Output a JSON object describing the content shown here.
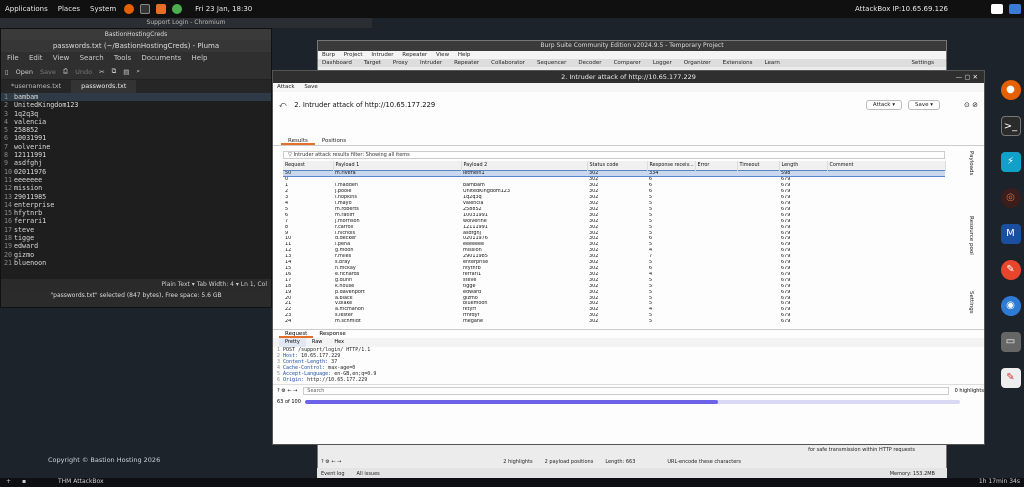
{
  "topbar": {
    "menus": [
      "Applications",
      "Places",
      "System"
    ],
    "clock": "Fri 23 Jan, 18:30",
    "attackbox": "AttackBox IP:10.65.69.126"
  },
  "chromium": {
    "title": "Support Login - Chromium",
    "copyright": "Copyright © Bastion Hosting 2026"
  },
  "pluma": {
    "tab_title": "BastionHostingCreds",
    "title": "passwords.txt (~/BastionHostingCreds) - Pluma",
    "menu": [
      "File",
      "Edit",
      "View",
      "Search",
      "Tools",
      "Documents",
      "Help"
    ],
    "toolbar": [
      "Open",
      "Save",
      "Undo"
    ],
    "tabs": [
      "*usernames.txt",
      "passwords.txt"
    ],
    "lines": [
      {
        "n": "1",
        "t": "bambam"
      },
      {
        "n": "2",
        "t": "UnitedKingdom123"
      },
      {
        "n": "3",
        "t": "1q2q3q"
      },
      {
        "n": "4",
        "t": "valencia"
      },
      {
        "n": "5",
        "t": "258852"
      },
      {
        "n": "6",
        "t": "10031991"
      },
      {
        "n": "7",
        "t": "wolverine"
      },
      {
        "n": "8",
        "t": "12111991"
      },
      {
        "n": "9",
        "t": "asdfghj"
      },
      {
        "n": "10",
        "t": "02011976"
      },
      {
        "n": "11",
        "t": "eeeeeee"
      },
      {
        "n": "12",
        "t": "mission"
      },
      {
        "n": "13",
        "t": "29011985"
      },
      {
        "n": "14",
        "t": "enterprise"
      },
      {
        "n": "15",
        "t": "hfytnrb"
      },
      {
        "n": "16",
        "t": "ferrari1"
      },
      {
        "n": "17",
        "t": "steve"
      },
      {
        "n": "18",
        "t": "tigge"
      },
      {
        "n": "19",
        "t": "edward"
      },
      {
        "n": "20",
        "t": "gizmo"
      },
      {
        "n": "21",
        "t": "bluenoon"
      }
    ],
    "status": "Plain Text ▾   Tab Width: 4 ▾   Ln 1, Col",
    "selection_info": "\"passwords.txt\" selected (847 bytes), Free space: 5.6 GB"
  },
  "burp": {
    "title": "Burp Suite Community Edition v2024.9.5 - Temporary Project",
    "menu": [
      "Burp",
      "Project",
      "Intruder",
      "Repeater",
      "View",
      "Help"
    ],
    "tabs": [
      "Dashboard",
      "Target",
      "Proxy",
      "Intruder",
      "Repeater",
      "Collaborator",
      "Sequencer",
      "Decoder",
      "Comparer",
      "Logger",
      "Organizer",
      "Extensions",
      "Learn"
    ],
    "settings": "Settings",
    "footer_highlights": "2 highlights",
    "footer_positions": "2 payload positions",
    "footer_length": "Length: 663",
    "event_log": "Event log",
    "all_issues": "All issues",
    "memory": "Memory: 153.2MB",
    "urlencode": "URL-encode these characters",
    "safe": "for safe transmission within HTTP requests"
  },
  "intruder": {
    "title": "2. Intruder attack of http://10.65.177.229",
    "menu": [
      "Attack",
      "Save"
    ],
    "heading": "2. Intruder attack of http://10.65.177.229",
    "attack_btn": "Attack ▾",
    "save_btn": "Save ▾",
    "subtabs": [
      "Results",
      "Positions"
    ],
    "filter": "Intruder attack results filter: Showing all items",
    "columns": [
      "Request",
      "Payload 1",
      "Payload 2",
      "Status code",
      "Response receiv...",
      "Error",
      "Timeout",
      "Length",
      "Comment"
    ],
    "rows": [
      [
        "50",
        "m.rivera",
        "letmein1",
        "302",
        "334",
        "",
        "",
        "598",
        ""
      ],
      [
        "0",
        "",
        "",
        "302",
        "6",
        "",
        "",
        "679",
        ""
      ],
      [
        "1",
        "l.madden",
        "bambam",
        "302",
        "6",
        "",
        "",
        "679",
        ""
      ],
      [
        "2",
        "j.poole",
        "UnitedKingdom123",
        "302",
        "6",
        "",
        "",
        "679",
        ""
      ],
      [
        "3",
        "l.hopkins",
        "1q2q3q",
        "302",
        "5",
        "",
        "",
        "679",
        ""
      ],
      [
        "4",
        "l.mayo",
        "valencia",
        "302",
        "5",
        "",
        "",
        "679",
        ""
      ],
      [
        "5",
        "m.roberts",
        "258852",
        "302",
        "5",
        "",
        "",
        "679",
        ""
      ],
      [
        "6",
        "m.ratliff",
        "10031991",
        "302",
        "5",
        "",
        "",
        "679",
        ""
      ],
      [
        "7",
        "j.morrison",
        "wolverine",
        "302",
        "5",
        "",
        "",
        "679",
        ""
      ],
      [
        "8",
        "r.carroll",
        "12111991",
        "302",
        "5",
        "",
        "",
        "679",
        ""
      ],
      [
        "9",
        "l.nichols",
        "asdfghj",
        "302",
        "5",
        "",
        "",
        "679",
        ""
      ],
      [
        "10",
        "d.decker",
        "02011976",
        "302",
        "6",
        "",
        "",
        "679",
        ""
      ],
      [
        "11",
        "l.pena",
        "eeeeeee",
        "302",
        "5",
        "",
        "",
        "679",
        ""
      ],
      [
        "12",
        "g.moon",
        "mission",
        "302",
        "4",
        "",
        "",
        "679",
        ""
      ],
      [
        "13",
        "r.miles",
        "29011985",
        "302",
        "7",
        "",
        "",
        "679",
        ""
      ],
      [
        "14",
        "s.bray",
        "enterprise",
        "302",
        "5",
        "",
        "",
        "679",
        ""
      ],
      [
        "15",
        "n.mckay",
        "hfytnrb",
        "302",
        "6",
        "",
        "",
        "679",
        ""
      ],
      [
        "16",
        "e.richards",
        "ferrari1",
        "302",
        "4",
        "",
        "",
        "679",
        ""
      ],
      [
        "17",
        "g.dunn",
        "steve",
        "302",
        "5",
        "",
        "",
        "679",
        ""
      ],
      [
        "18",
        "k.house",
        "tigge",
        "302",
        "5",
        "",
        "",
        "679",
        ""
      ],
      [
        "19",
        "p.davenport",
        "edward",
        "302",
        "5",
        "",
        "",
        "679",
        ""
      ],
      [
        "20",
        "a.black",
        "gizmo",
        "302",
        "5",
        "",
        "",
        "679",
        ""
      ],
      [
        "21",
        "v.blake",
        "bluemoon",
        "302",
        "5",
        "",
        "",
        "679",
        ""
      ],
      [
        "22",
        "a.mcmahon",
        "fktyrf",
        "302",
        "4",
        "",
        "",
        "679",
        ""
      ],
      [
        "23",
        "s.lester",
        "rfhfdyf",
        "302",
        "5",
        "",
        "",
        "679",
        ""
      ],
      [
        "24",
        "m.schmidt",
        "megane",
        "302",
        "5",
        "",
        "",
        "679",
        ""
      ]
    ],
    "rr_tabs": [
      "Request",
      "Response"
    ],
    "rr_sub": [
      "Pretty",
      "Raw",
      "Hex"
    ],
    "request_lines": [
      {
        "n": "1",
        "k": "",
        "v": "POST /support/login/ HTTP/1.1"
      },
      {
        "n": "2",
        "k": "Host:",
        "v": " 10.65.177.229"
      },
      {
        "n": "3",
        "k": "Content-Length:",
        "v": " 37"
      },
      {
        "n": "4",
        "k": "Cache-Control:",
        "v": " max-age=0"
      },
      {
        "n": "5",
        "k": "Accept-Language:",
        "v": " en-GB,en;q=0.9"
      },
      {
        "n": "6",
        "k": "Origin:",
        "v": " http://10.65.177.229"
      }
    ],
    "search_placeholder": "Search",
    "highlights": "0 highlights",
    "progress_text": "63 of 100",
    "progress": 0.63,
    "side_labels": [
      "Payloads",
      "Resource pool",
      "Settings"
    ]
  },
  "bottombar": {
    "task": "THM AttackBox",
    "timer": "1h 17min 34s"
  }
}
